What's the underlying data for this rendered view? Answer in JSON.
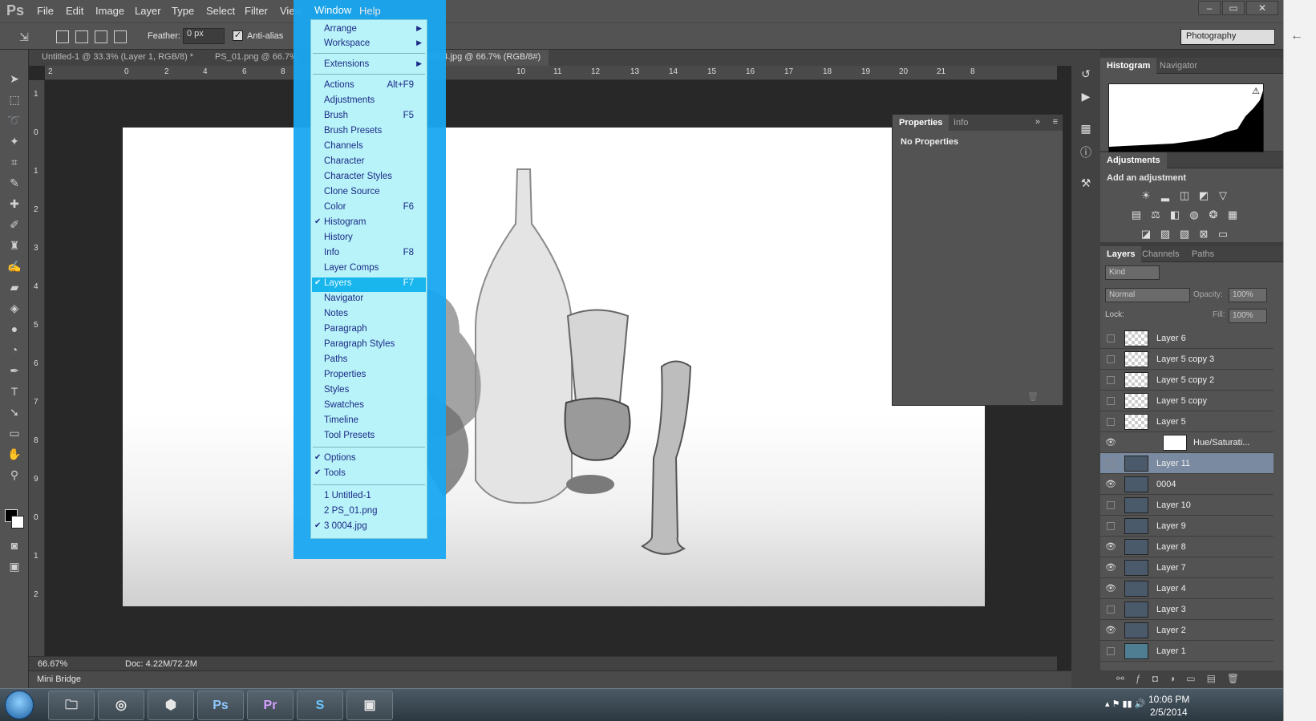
{
  "app": {
    "logo": "Ps"
  },
  "menubar": {
    "items": [
      "File",
      "Edit",
      "Image",
      "Layer",
      "Type",
      "Select",
      "Filter",
      "View",
      "Window",
      "Help"
    ],
    "window_buttons": [
      "–",
      "▭",
      "✕"
    ]
  },
  "options": {
    "feather_label": "Feather:",
    "feather_value": "0 px",
    "antialias_label": "Anti-alias",
    "workspace": "Photography"
  },
  "tabs": [
    "Untitled-1 @ 33.3% (Layer 1, RGB/8) *",
    "PS_01.png @ 66.7%",
    "0004.jpg @ 66.7% (RGB/8#)"
  ],
  "rulers": {
    "top": [
      "2",
      "0",
      "2",
      "4",
      "6",
      "8",
      "10",
      "11",
      "12",
      "13",
      "14",
      "15",
      "16",
      "17",
      "18",
      "19",
      "20",
      "21",
      "8"
    ],
    "left": [
      "1",
      "0",
      "1",
      "2",
      "3",
      "4",
      "5",
      "6",
      "7",
      "8",
      "9",
      "0",
      "1",
      "2"
    ]
  },
  "status": {
    "zoom": "66.67%",
    "doc": "Doc: 4.22M/72.2M",
    "mini_bridge": "Mini Bridge"
  },
  "properties_panel": {
    "tabs": [
      "Properties",
      "Info"
    ],
    "body": "No Properties"
  },
  "right_panels": {
    "top_tabs": [
      "Histogram",
      "Navigator"
    ],
    "adj_tabs": [
      "Adjustments"
    ],
    "adj_title": "Add an adjustment",
    "layers_tabs": [
      "Layers",
      "Channels",
      "Paths"
    ],
    "kind": "Kind",
    "blend": "Normal",
    "opacity_label": "Opacity:",
    "opacity_value": "100%",
    "lock_label": "Lock:",
    "fill_label": "Fill:",
    "fill_value": "100%",
    "layers": [
      {
        "name": "Layer 6",
        "visible": false,
        "thumb": "checker"
      },
      {
        "name": "Layer 5 copy 3",
        "visible": false,
        "thumb": "checker"
      },
      {
        "name": "Layer 5 copy 2",
        "visible": false,
        "thumb": "checker"
      },
      {
        "name": "Layer 5 copy",
        "visible": false,
        "thumb": "checker"
      },
      {
        "name": "Layer 5",
        "visible": false,
        "thumb": "checker"
      },
      {
        "name": "Hue/Saturati...",
        "visible": true,
        "thumb": "adjust"
      },
      {
        "name": "Layer 11",
        "visible": false,
        "thumb": "img",
        "selected": true
      },
      {
        "name": "0004",
        "visible": true,
        "thumb": "img"
      },
      {
        "name": "Layer 10",
        "visible": false,
        "thumb": "img"
      },
      {
        "name": "Layer 9",
        "visible": false,
        "thumb": "img"
      },
      {
        "name": "Layer 8",
        "visible": true,
        "thumb": "img"
      },
      {
        "name": "Layer 7",
        "visible": true,
        "thumb": "img"
      },
      {
        "name": "Layer 4",
        "visible": true,
        "thumb": "img"
      },
      {
        "name": "Layer 3",
        "visible": false,
        "thumb": "img"
      },
      {
        "name": "Layer 2",
        "visible": true,
        "thumb": "img"
      },
      {
        "name": "Layer 1",
        "visible": false,
        "thumb": "blue"
      }
    ]
  },
  "window_menu": {
    "items": [
      {
        "label": "Arrange",
        "submenu": true
      },
      {
        "label": "Workspace",
        "submenu": true
      },
      {
        "sep": true
      },
      {
        "label": "Extensions",
        "submenu": true
      },
      {
        "sep": true
      },
      {
        "label": "Actions",
        "shortcut": "Alt+F9"
      },
      {
        "label": "Adjustments"
      },
      {
        "label": "Brush",
        "shortcut": "F5"
      },
      {
        "label": "Brush Presets"
      },
      {
        "label": "Channels"
      },
      {
        "label": "Character"
      },
      {
        "label": "Character Styles"
      },
      {
        "label": "Clone Source"
      },
      {
        "label": "Color",
        "shortcut": "F6"
      },
      {
        "label": "Histogram",
        "checked": true
      },
      {
        "label": "History"
      },
      {
        "label": "Info",
        "shortcut": "F8"
      },
      {
        "label": "Layer Comps"
      },
      {
        "label": "Layers",
        "shortcut": "F7",
        "checked": true,
        "highlighted": true
      },
      {
        "label": "Navigator"
      },
      {
        "label": "Notes"
      },
      {
        "label": "Paragraph"
      },
      {
        "label": "Paragraph Styles"
      },
      {
        "label": "Paths"
      },
      {
        "label": "Properties"
      },
      {
        "label": "Styles"
      },
      {
        "label": "Swatches"
      },
      {
        "label": "Timeline"
      },
      {
        "label": "Tool Presets"
      },
      {
        "sep": true
      },
      {
        "label": "Options",
        "checked": true
      },
      {
        "label": "Tools",
        "checked": true
      },
      {
        "sep": true
      },
      {
        "label": "1 Untitled-1"
      },
      {
        "label": "2 PS_01.png"
      },
      {
        "label": "3 0004.jpg",
        "checked": true
      }
    ]
  },
  "taskbar": {
    "apps": [
      "explorer",
      "chrome",
      "sketchup",
      "Ps",
      "Pr",
      "S",
      "photos"
    ],
    "time": "10:06 PM",
    "date": "2/5/2014"
  }
}
